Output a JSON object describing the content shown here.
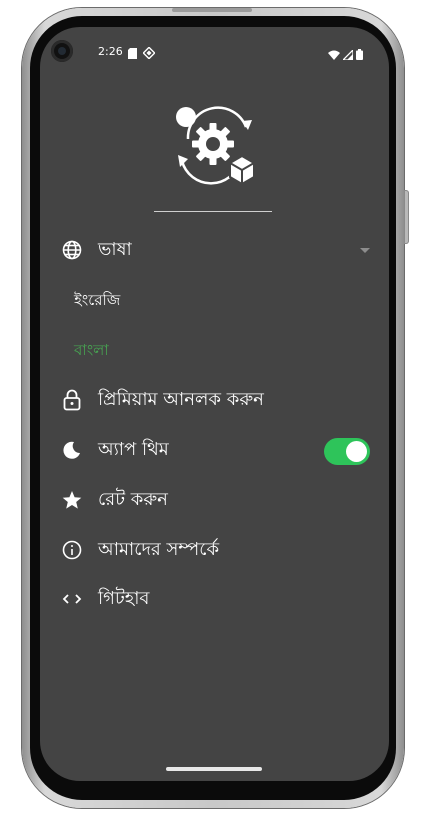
{
  "status_bar": {
    "time": "2:26",
    "left_icons": [
      "sd-card-icon",
      "sync-icon"
    ],
    "right_icons": [
      "wifi-icon",
      "signal-icon",
      "battery-icon"
    ]
  },
  "app": {
    "logo_icon": "settings-cycle-icon"
  },
  "menu": {
    "language": {
      "label": "ভাষা",
      "icon": "globe-icon",
      "options": [
        {
          "label": "ইংরেজি",
          "selected": false
        },
        {
          "label": "বাংলা",
          "selected": true
        }
      ]
    },
    "premium": {
      "label": "প্রিমিয়াম আনলক করুন",
      "icon": "lock-icon"
    },
    "theme": {
      "label": "অ্যাপ থিম",
      "icon": "moon-icon",
      "dark_mode_on": true
    },
    "rate": {
      "label": "রেট করুন",
      "icon": "star-icon"
    },
    "about": {
      "label": "আমাদের সম্পর্কে",
      "icon": "info-icon"
    },
    "github": {
      "label": "গিটহাব",
      "icon": "code-icon"
    }
  },
  "colors": {
    "screen_bg": "#444444",
    "selected_text": "#47a652",
    "toggle_on": "#2ec45a"
  }
}
